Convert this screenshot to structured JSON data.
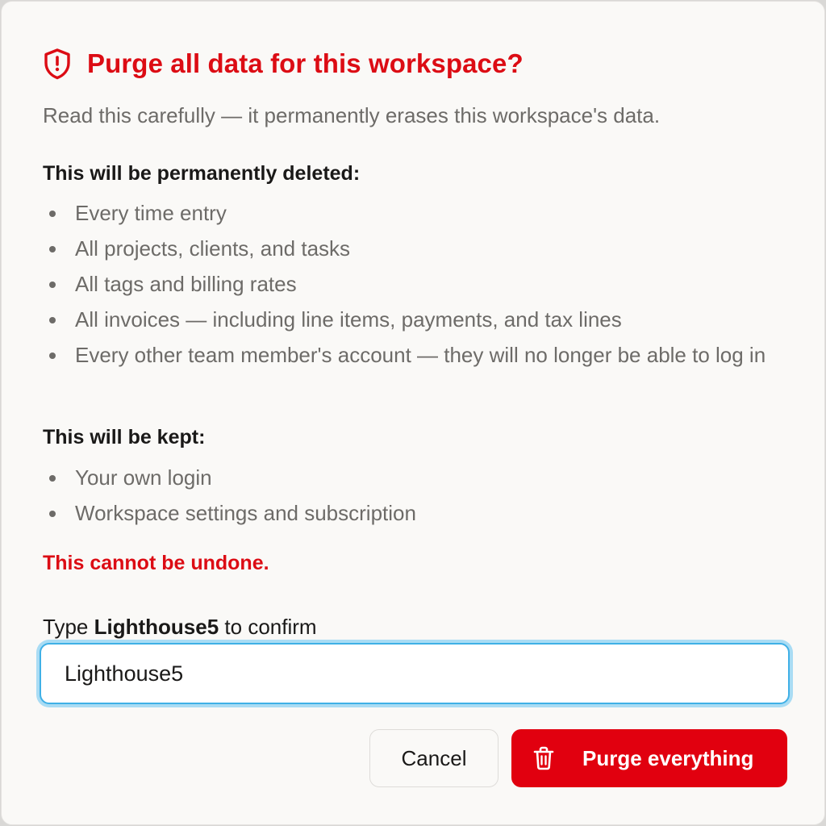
{
  "dialog": {
    "title": "Purge all data for this workspace?",
    "title_icon": "shield-alert-icon",
    "subtitle": "Read this carefully — it permanently erases this workspace's data.",
    "deleted": {
      "heading": "This will be permanently deleted:",
      "items": [
        "Every time entry",
        "All projects, clients, and tasks",
        "All tags and billing rates",
        "All invoices — including line items, payments, and tax lines",
        "Every other team member's account — they will no longer be able to log in"
      ]
    },
    "kept": {
      "heading": "This will be kept:",
      "items": [
        "Your own login",
        "Workspace settings and subscription"
      ]
    },
    "warning": "This cannot be undone.",
    "confirm": {
      "label_prefix": "Type",
      "label_keyword": "Lighthouse5",
      "label_suffix": "to confirm",
      "value": "Lighthouse5"
    },
    "buttons": {
      "cancel": "Cancel",
      "purge": "Purge everything",
      "purge_icon": "trash-icon"
    }
  },
  "colors": {
    "danger": "#dc0c14",
    "focus_ring": "#3fb0e6",
    "muted_text": "#6d6b68"
  }
}
